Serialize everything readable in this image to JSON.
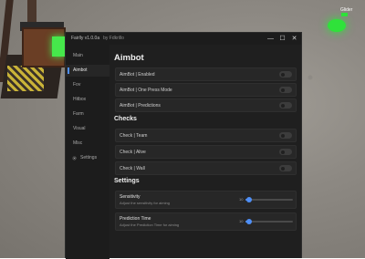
{
  "window": {
    "title": "Fairlly v1.0.0a",
    "subtitle": "by Fdkrillo",
    "controls": {
      "minimize": "—",
      "maximize": "☐",
      "close": "✕"
    }
  },
  "hud": {
    "player_tag": "Glider"
  },
  "sidebar": {
    "items": [
      {
        "label": "Main"
      },
      {
        "label": "Aimbot"
      },
      {
        "label": "Fov"
      },
      {
        "label": "Hitbox"
      },
      {
        "label": "Farm"
      },
      {
        "label": "Visual"
      },
      {
        "label": "Misc"
      },
      {
        "label": "Settings",
        "icon": "gear-icon"
      }
    ],
    "active_index": 1
  },
  "main": {
    "title": "Aimbot",
    "aimbot_toggles": [
      {
        "label": "AimBot | Enabled",
        "on": false
      },
      {
        "label": "AimBot | One Press Mode",
        "on": false
      },
      {
        "label": "AimBot | Predictions",
        "on": false
      }
    ],
    "checks_title": "Checks",
    "check_toggles": [
      {
        "label": "Check | Team",
        "on": false
      },
      {
        "label": "Check | Alive",
        "on": false
      },
      {
        "label": "Check | Wall",
        "on": false
      }
    ],
    "settings_title": "Settings",
    "sliders": [
      {
        "name": "Sensitivity",
        "description": "Adjust the sensitivity for aiming",
        "value": "10",
        "fraction": 0.08
      },
      {
        "name": "Prediction Time",
        "description": "Adjust the Prediction Time for aiming",
        "value": "10",
        "fraction": 0.08
      }
    ]
  },
  "colors": {
    "accent": "#4f8ff7",
    "window_bg": "#1f1f1f",
    "row_bg": "#272727"
  }
}
